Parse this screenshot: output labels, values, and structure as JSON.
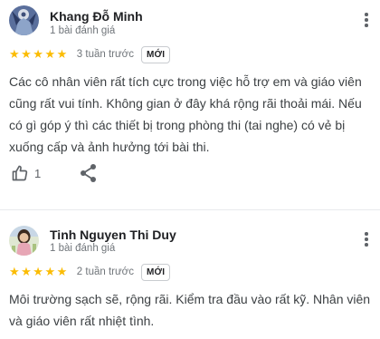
{
  "reviews": [
    {
      "author": "Khang Đỗ Minh",
      "review_count": "1 bài đánh giá",
      "stars": "★★★★★",
      "time": "3 tuần trước",
      "badge": "MỚI",
      "text": "Các cô nhân viên rất tích cực trong việc hỗ trợ em và giáo viên cũng rất vui tính. Không gian ở đây khá rộng rãi thoải mái. Nếu có gì góp ý thì các thiết bị trong phòng thi (tai nghe) có vẻ bị xuống cấp và ảnh hưởng tới bài thi.",
      "likes": "1"
    },
    {
      "author": "Tinh Nguyen Thi Duy",
      "review_count": "1 bài đánh giá",
      "stars": "★★★★★",
      "time": "2 tuần trước",
      "badge": "MỚI",
      "text": "Môi trường sạch sẽ, rộng rãi. Kiểm tra đầu vào rất kỹ. Nhân viên và giáo viên rất nhiệt tình."
    }
  ],
  "colors": {
    "star": "#fbbc04",
    "secondary_text": "#70757a",
    "icon": "#5f6368"
  },
  "icons": [
    "more-options-icon",
    "thumbs-up-icon",
    "share-icon"
  ]
}
